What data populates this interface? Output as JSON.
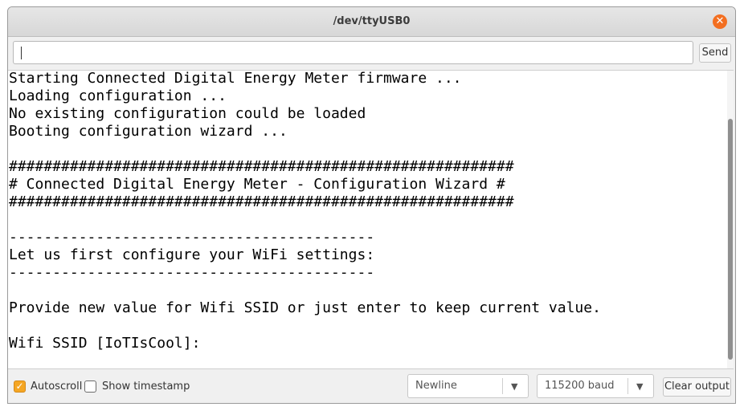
{
  "window": {
    "title": "/dev/ttyUSB0",
    "close_symbol": "✕"
  },
  "input": {
    "value": ""
  },
  "send_label": "Send",
  "console_lines": [
    "Starting Connected Digital Energy Meter firmware ...",
    "Loading configuration ...",
    "No existing configuration could be loaded",
    "Booting configuration wizard ...",
    "",
    "##########################################################",
    "# Connected Digital Energy Meter - Configuration Wizard #",
    "##########################################################",
    "",
    "------------------------------------------",
    "Let us first configure your WiFi settings:",
    "------------------------------------------",
    "",
    "Provide new value for Wifi SSID or just enter to keep current value.",
    "",
    "Wifi SSID [IoTIsCool]:"
  ],
  "footer": {
    "autoscroll_label": "Autoscroll",
    "autoscroll_checked": true,
    "timestamp_label": "Show timestamp",
    "timestamp_checked": false,
    "line_ending": "Newline",
    "baud": "115200 baud",
    "clear_label": "Clear output"
  },
  "colors": {
    "accent": "#f5a623",
    "close": "#f36f21"
  },
  "icons": {
    "close": "close-icon",
    "check": "checkmark-icon",
    "dropdown": "chevron-down-icon"
  }
}
